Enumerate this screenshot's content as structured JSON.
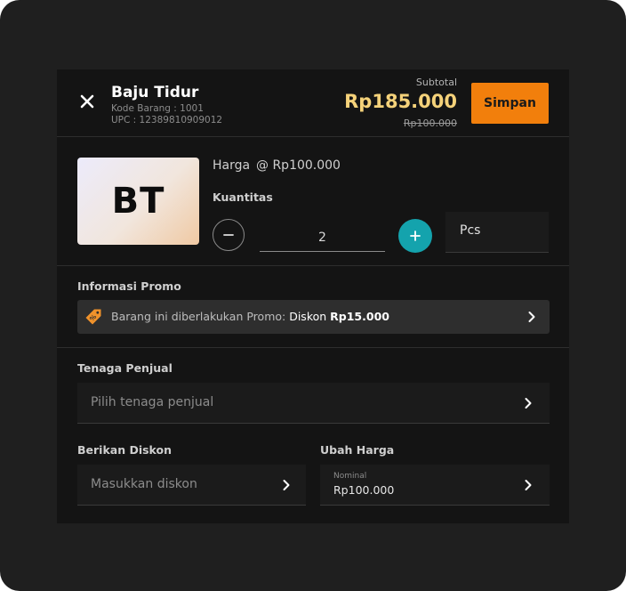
{
  "header": {
    "product_name": "Baju Tidur",
    "product_code": "Kode Barang : 1001",
    "upc": "UPC : 12389810909012",
    "subtotal_label": "Subtotal",
    "subtotal_value": "Rp185.000",
    "subtotal_original": "Rp100.000",
    "save_label": "Simpan"
  },
  "product": {
    "thumbnail_initials": "BT",
    "price_label": "Harga",
    "price_value": "@ Rp100.000",
    "quantity_label": "Kuantitas",
    "quantity_value": "2",
    "unit": "Pcs"
  },
  "promo": {
    "section_label": "Informasi Promo",
    "text_prefix": "Barang ini diberlakukan Promo: ",
    "promo_name": "Diskon ",
    "promo_amount": "Rp15.000"
  },
  "sales": {
    "section_label": "Tenaga Penjual",
    "placeholder": "Pilih tenaga penjual"
  },
  "discount": {
    "section_label": "Berikan Diskon",
    "placeholder": "Masukkan diskon"
  },
  "price_change": {
    "section_label": "Ubah Harga",
    "field_label": "Nominal",
    "value": "Rp100.000"
  },
  "colors": {
    "accent_orange": "#f27f0c",
    "accent_teal": "#14a3ad",
    "subtotal_yellow": "#f5d27a",
    "panel_background": "#141414"
  },
  "icons": [
    "close-icon",
    "minus-icon",
    "plus-icon",
    "promo-tag-icon",
    "chevron-right-icon"
  ]
}
